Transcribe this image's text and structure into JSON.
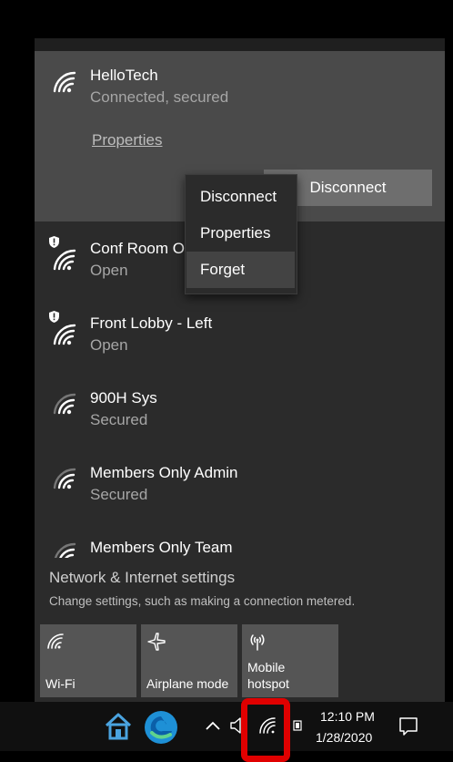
{
  "connected_network": {
    "name": "HelloTech",
    "status": "Connected, secured",
    "properties_link": "Properties",
    "disconnect_button": "Disconnect"
  },
  "context_menu": {
    "items": [
      "Disconnect",
      "Properties",
      "Forget"
    ],
    "highlighted_item": "Forget"
  },
  "networks": [
    {
      "name": "Conf Room O",
      "status": "Open",
      "icon": "wifi-warning-icon"
    },
    {
      "name": "Front Lobby - Left",
      "status": "Open",
      "icon": "wifi-warning-icon"
    },
    {
      "name": "900H Sys",
      "status": "Secured",
      "icon": "wifi-icon"
    },
    {
      "name": "Members Only Admin",
      "status": "Secured",
      "icon": "wifi-icon"
    },
    {
      "name": "Members Only Team",
      "status": "",
      "icon": "wifi-icon"
    }
  ],
  "settings": {
    "title": "Network & Internet settings",
    "subtitle": "Change settings, such as making a connection metered."
  },
  "quick_actions": [
    {
      "label": "Wi-Fi",
      "icon": "wifi-icon"
    },
    {
      "label": "Airplane mode",
      "icon": "airplane-icon"
    },
    {
      "label": "Mobile hotspot",
      "icon": "hotspot-icon"
    }
  ],
  "taskbar": {
    "time": "12:10 PM",
    "date": "1/28/2020",
    "icons": [
      "home-icon",
      "edge-icon",
      "chevron-up-icon",
      "volume-icon",
      "wifi-icon",
      "battery-icon",
      "notification-icon"
    ]
  },
  "colors": {
    "highlight_box": "#e00000",
    "flyout_bg": "#2b2b2b",
    "connected_bg": "#4a4a4a",
    "edge_blue": "#1e90d6",
    "home_blue": "#4aa3df"
  }
}
